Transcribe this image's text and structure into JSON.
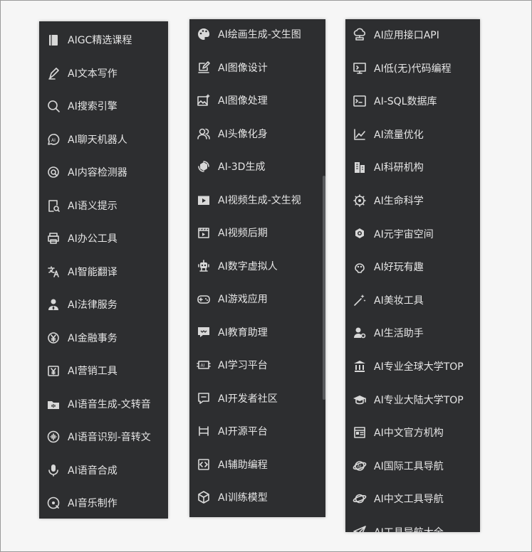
{
  "columns": [
    {
      "items": [
        {
          "label": "AIGC精选课程",
          "icon": "book-icon"
        },
        {
          "label": "AI文本写作",
          "icon": "pen-icon"
        },
        {
          "label": "AI搜索引擎",
          "icon": "search-icon"
        },
        {
          "label": "AI聊天机器人",
          "icon": "ai-head-icon"
        },
        {
          "label": "AI内容检测器",
          "icon": "scan-target-icon"
        },
        {
          "label": "AI语义提示",
          "icon": "doc-search-icon"
        },
        {
          "label": "AI办公工具",
          "icon": "printer-icon"
        },
        {
          "label": "AI智能翻译",
          "icon": "translate-icon"
        },
        {
          "label": "AI法律服务",
          "icon": "lawyer-icon"
        },
        {
          "label": "AI金融事务",
          "icon": "yen-coin-icon"
        },
        {
          "label": "AI营销工具",
          "icon": "yen-box-icon"
        },
        {
          "label": "AI语音生成-文转音",
          "icon": "audio-folder-icon"
        },
        {
          "label": "AI语音识别-音转文",
          "icon": "voice-wave-icon"
        },
        {
          "label": "AI语音合成",
          "icon": "microphone-icon"
        },
        {
          "label": "AI音乐制作",
          "icon": "music-disc-icon"
        }
      ]
    },
    {
      "items": [
        {
          "label": "AI绘画生成-文生图",
          "icon": "palette-icon"
        },
        {
          "label": "AI图像设计",
          "icon": "edit-image-icon"
        },
        {
          "label": "AI图像处理",
          "icon": "image-sparkle-icon"
        },
        {
          "label": "AI头像化身",
          "icon": "users-icon"
        },
        {
          "label": "AI-3D生成",
          "icon": "cube-rotate-icon"
        },
        {
          "label": "AI视频生成-文生视",
          "icon": "video-play-icon"
        },
        {
          "label": "AI视频后期",
          "icon": "clapper-icon"
        },
        {
          "label": "AI数字虚拟人",
          "icon": "robot-icon"
        },
        {
          "label": "AI游戏应用",
          "icon": "gamepad-icon"
        },
        {
          "label": "AI教育助理",
          "icon": "chat-box-icon"
        },
        {
          "label": "AI学习平台",
          "icon": "ai-chip-icon"
        },
        {
          "label": "AI开发者社区",
          "icon": "comment-icon"
        },
        {
          "label": "AI开源平台",
          "icon": "bracket-box-icon"
        },
        {
          "label": "AI辅助编程",
          "icon": "code-icon"
        },
        {
          "label": "AI训练模型",
          "icon": "model-box-icon"
        }
      ]
    },
    {
      "items": [
        {
          "label": "AI应用接口API",
          "icon": "cloud-network-icon"
        },
        {
          "label": "AI低(无)代码编程",
          "icon": "monitor-icon"
        },
        {
          "label": "AI-SQL数据库",
          "icon": "terminal-icon"
        },
        {
          "label": "AI流量优化",
          "icon": "trend-chart-icon"
        },
        {
          "label": "AI科研机构",
          "icon": "building-icon"
        },
        {
          "label": "AI生命科学",
          "icon": "gear-atom-icon"
        },
        {
          "label": "AI元宇宙空间",
          "icon": "globe-gear-icon"
        },
        {
          "label": "AI好玩有趣",
          "icon": "fun-face-icon"
        },
        {
          "label": "AI美妆工具",
          "icon": "magic-wand-icon"
        },
        {
          "label": "AI生活助手",
          "icon": "user-gear-icon"
        },
        {
          "label": "AI专业全球大学TOP",
          "icon": "bank-icon"
        },
        {
          "label": "AI专业大陆大学TOP",
          "icon": "graduation-cap-icon"
        },
        {
          "label": "AI中文官方机构",
          "icon": "newspaper-icon"
        },
        {
          "label": "AI国际工具导航",
          "icon": "planet-ai-icon"
        },
        {
          "label": "AI中文工具导航",
          "icon": "planet-icon"
        },
        {
          "label": "AI工具导航大全",
          "icon": "send-icon"
        }
      ]
    }
  ],
  "colors": {
    "panel_bg": "#2d2e30",
    "text": "#e6e6e6",
    "icon": "#d8d8d8",
    "page_bg": "#f6f6f6"
  }
}
